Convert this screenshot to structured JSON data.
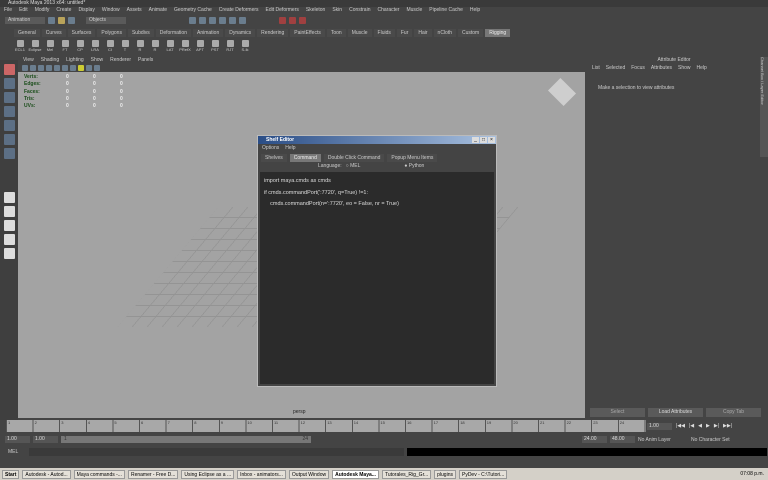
{
  "window": {
    "title": "Autodesk Maya 2013 x64: untitled*"
  },
  "menu": [
    "File",
    "Edit",
    "Modify",
    "Create",
    "Display",
    "Window",
    "Assets",
    "Animate",
    "Geometry Cache",
    "Create Deformers",
    "Edit Deformers",
    "Skeleton",
    "Skin",
    "Constrain",
    "Character",
    "Muscle",
    "Pipeline Cache",
    "Help"
  ],
  "status": {
    "menuset": "Animation",
    "objects": "Objects"
  },
  "shelf_tabs": [
    "General",
    "Curves",
    "Surfaces",
    "Polygons",
    "Subdivs",
    "Deformation",
    "Animation",
    "Dynamics",
    "Rendering",
    "PaintEffects",
    "Toon",
    "Muscle",
    "Fluids",
    "Fur",
    "Hair",
    "nCloth",
    "Custom",
    "Rigging"
  ],
  "shelf_buttons": [
    "ECL1",
    "Eclipse",
    "Mel",
    "FT",
    "CP",
    "LRA",
    "CI",
    "T",
    "R",
    "R",
    "LAT",
    "PRefX",
    "APT",
    "PST",
    "RJT",
    "S-Ik"
  ],
  "viewport": {
    "menu": [
      "View",
      "Shading",
      "Lighting",
      "Show",
      "Renderer",
      "Panels"
    ],
    "hud": [
      {
        "label": "Verts:",
        "v": [
          "0",
          "0",
          "0"
        ]
      },
      {
        "label": "Edges:",
        "v": [
          "0",
          "0",
          "0"
        ]
      },
      {
        "label": "Faces:",
        "v": [
          "0",
          "0",
          "0"
        ]
      },
      {
        "label": "Tris:",
        "v": [
          "0",
          "0",
          "0"
        ]
      },
      {
        "label": "UVs:",
        "v": [
          "0",
          "0",
          "0"
        ]
      }
    ],
    "camera": "persp"
  },
  "attribute_editor": {
    "title": "Attribute Editor",
    "menu": [
      "List",
      "Selected",
      "Focus",
      "Attributes",
      "Show",
      "Help"
    ],
    "message": "Make a selection to view attributes",
    "buttons": [
      "Select",
      "Load Attributes",
      "Copy Tab"
    ],
    "side_tab": "Channel Box / Layer Editor"
  },
  "shelf_editor": {
    "title": "Shelf Editor",
    "menu": [
      "Options",
      "Help"
    ],
    "tabs": [
      "Shelves",
      "Command",
      "Double Click Command",
      "Popup Menu Items"
    ],
    "language_label": "Language:",
    "languages": [
      "MEL",
      "Python"
    ],
    "code": [
      "import maya.cmds as cmds",
      "if cmds.commandPort(':7720', q=True) !=1:",
      "    cmds.commandPort(n=':7720', eo = False, nr = True)"
    ]
  },
  "timeline": {
    "ticks": [
      "1",
      "2",
      "3",
      "4",
      "5",
      "6",
      "7",
      "8",
      "9",
      "10",
      "11",
      "12",
      "13",
      "14",
      "15",
      "16",
      "17",
      "18",
      "19",
      "20",
      "21",
      "22",
      "23",
      "24"
    ],
    "current": "1.00"
  },
  "range": {
    "start": "1.00",
    "playback_start": "1.00",
    "slider_start": "1",
    "slider_end": "24",
    "playback_end": "24.00",
    "end": "48.00",
    "anim_layer": "No Anim Layer",
    "character_set": "No Character Set"
  },
  "command_line": {
    "label": "MEL"
  },
  "taskbar": {
    "start": "Start",
    "items": [
      "Autodesk - Autod...",
      "Maya commands -...",
      "Renamer - Free D...",
      "Using Eclipse as a ...",
      "Inbox - animators...",
      "Output Window",
      "Autodesk Maya...",
      "Tutorales_Rig_Gr...",
      "plugins",
      "PyDev - C:\\Tutori..."
    ],
    "active": "Autodesk Maya...",
    "clock": "07:08 p.m."
  }
}
